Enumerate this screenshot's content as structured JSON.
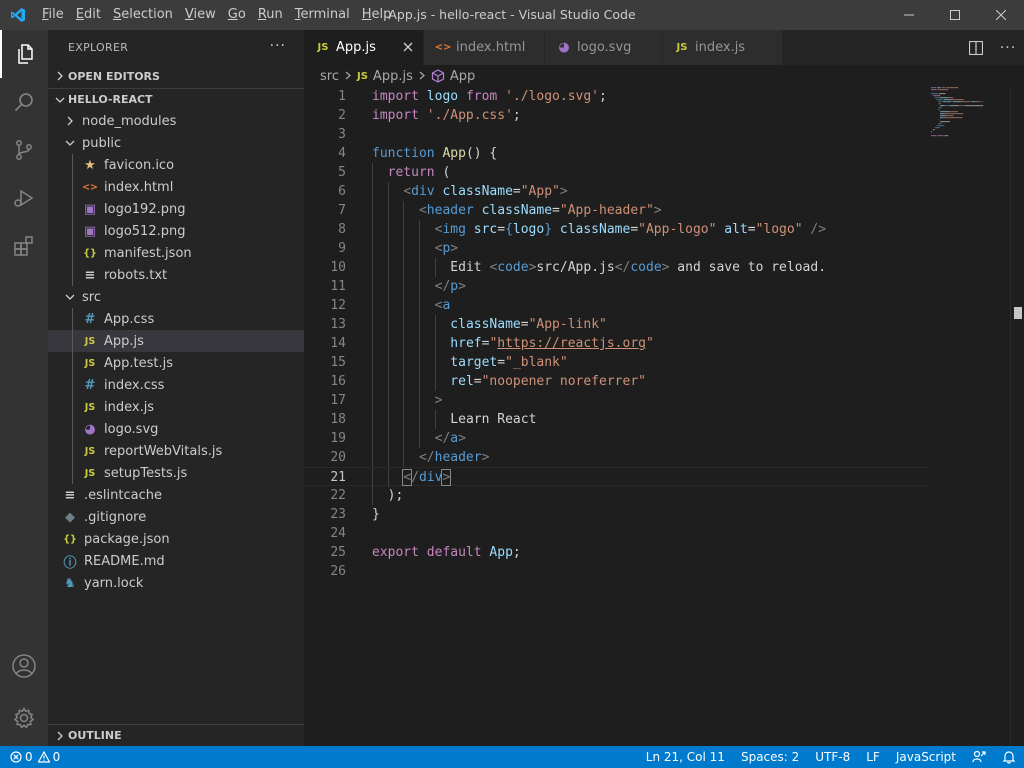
{
  "window": {
    "title": "App.js - hello-react - Visual Studio Code"
  },
  "menu": [
    {
      "u": "F",
      "rest": "ile"
    },
    {
      "u": "E",
      "rest": "dit"
    },
    {
      "u": "S",
      "rest": "election"
    },
    {
      "u": "V",
      "rest": "iew"
    },
    {
      "u": "G",
      "rest": "o"
    },
    {
      "u": "R",
      "rest": "un"
    },
    {
      "u": "T",
      "rest": "erminal"
    },
    {
      "u": "H",
      "rest": "elp"
    }
  ],
  "sidebar": {
    "title": "EXPLORER",
    "open_editors": "OPEN EDITORS",
    "project": "HELLO-REACT",
    "outline": "OUTLINE",
    "tree": [
      {
        "label": "node_modules",
        "type": "folder",
        "open": false,
        "depth": 1
      },
      {
        "label": "public",
        "type": "folder",
        "open": true,
        "depth": 1
      },
      {
        "label": "favicon.ico",
        "type": "file",
        "icon": "star-icon",
        "glyph": "★",
        "color": "#e5c07b",
        "depth": 2
      },
      {
        "label": "index.html",
        "type": "file",
        "icon": "html-icon",
        "glyph": "<>",
        "color": "#e37933",
        "depth": 2
      },
      {
        "label": "logo192.png",
        "type": "file",
        "icon": "image-icon",
        "glyph": "▣",
        "color": "#a074c4",
        "depth": 2
      },
      {
        "label": "logo512.png",
        "type": "file",
        "icon": "image-icon",
        "glyph": "▣",
        "color": "#a074c4",
        "depth": 2
      },
      {
        "label": "manifest.json",
        "type": "file",
        "icon": "json-icon",
        "glyph": "{}",
        "color": "#cbcb41",
        "depth": 2
      },
      {
        "label": "robots.txt",
        "type": "file",
        "icon": "text-file-icon",
        "glyph": "≡",
        "color": "#cccccc",
        "depth": 2
      },
      {
        "label": "src",
        "type": "folder",
        "open": true,
        "depth": 1
      },
      {
        "label": "App.css",
        "type": "file",
        "icon": "css-icon",
        "glyph": "#",
        "color": "#519aba",
        "depth": 2
      },
      {
        "label": "App.js",
        "type": "file",
        "icon": "js-icon",
        "glyph": "JS",
        "color": "#cbcb41",
        "depth": 2,
        "selected": true
      },
      {
        "label": "App.test.js",
        "type": "file",
        "icon": "js-icon",
        "glyph": "JS",
        "color": "#cbcb41",
        "depth": 2
      },
      {
        "label": "index.css",
        "type": "file",
        "icon": "css-icon",
        "glyph": "#",
        "color": "#519aba",
        "depth": 2
      },
      {
        "label": "index.js",
        "type": "file",
        "icon": "js-icon",
        "glyph": "JS",
        "color": "#cbcb41",
        "depth": 2
      },
      {
        "label": "logo.svg",
        "type": "file",
        "icon": "svg-icon",
        "glyph": "◕",
        "color": "#a074c4",
        "depth": 2
      },
      {
        "label": "reportWebVitals.js",
        "type": "file",
        "icon": "js-icon",
        "glyph": "JS",
        "color": "#cbcb41",
        "depth": 2
      },
      {
        "label": "setupTests.js",
        "type": "file",
        "icon": "js-icon",
        "glyph": "JS",
        "color": "#cbcb41",
        "depth": 2
      },
      {
        "label": ".eslintcache",
        "type": "file",
        "icon": "text-file-icon",
        "glyph": "≡",
        "color": "#cccccc",
        "depth": 1
      },
      {
        "label": ".gitignore",
        "type": "file",
        "icon": "git-icon",
        "glyph": "◆",
        "color": "#6d8086",
        "depth": 1
      },
      {
        "label": "package.json",
        "type": "file",
        "icon": "json-icon",
        "glyph": "{}",
        "color": "#cbcb41",
        "depth": 1
      },
      {
        "label": "README.md",
        "type": "file",
        "icon": "info-icon",
        "glyph": "ⓘ",
        "color": "#519aba",
        "depth": 1
      },
      {
        "label": "yarn.lock",
        "type": "file",
        "icon": "yarn-icon",
        "glyph": "♞",
        "color": "#519aba",
        "depth": 1
      }
    ]
  },
  "tabs": [
    {
      "label": "App.js",
      "icon": "js-icon",
      "glyph": "JS",
      "color": "#cbcb41",
      "active": true,
      "width": 120
    },
    {
      "label": "index.html",
      "icon": "html-icon",
      "glyph": "<>",
      "color": "#e37933",
      "active": false,
      "width": 121
    },
    {
      "label": "logo.svg",
      "icon": "svg-icon",
      "glyph": "◕",
      "color": "#a074c4",
      "active": false,
      "width": 118
    },
    {
      "label": "index.js",
      "icon": "js-icon",
      "glyph": "JS",
      "color": "#cbcb41",
      "active": false,
      "width": 120
    }
  ],
  "breadcrumb": {
    "folder": "src",
    "file": "App.js",
    "symbol": "App"
  },
  "editor": {
    "current_line": 21,
    "lines": [
      {
        "n": 1,
        "indent": 0,
        "t": [
          [
            "kw",
            "import"
          ],
          [
            "text",
            " "
          ],
          [
            "var",
            "logo"
          ],
          [
            "text",
            " "
          ],
          [
            "kw",
            "from"
          ],
          [
            "text",
            " "
          ],
          [
            "str",
            "'./logo.svg'"
          ],
          [
            "text",
            ";"
          ]
        ]
      },
      {
        "n": 2,
        "indent": 0,
        "t": [
          [
            "kw",
            "import"
          ],
          [
            "text",
            " "
          ],
          [
            "str",
            "'./App.css'"
          ],
          [
            "text",
            ";"
          ]
        ]
      },
      {
        "n": 3,
        "indent": 0,
        "t": []
      },
      {
        "n": 4,
        "indent": 0,
        "t": [
          [
            "blue",
            "function"
          ],
          [
            "text",
            " "
          ],
          [
            "fn",
            "App"
          ],
          [
            "text",
            "() {"
          ]
        ]
      },
      {
        "n": 5,
        "indent": 1,
        "t": [
          [
            "kw",
            "return"
          ],
          [
            "text",
            " ("
          ]
        ]
      },
      {
        "n": 6,
        "indent": 2,
        "t": [
          [
            "punct",
            "<"
          ],
          [
            "tag",
            "div"
          ],
          [
            "text",
            " "
          ],
          [
            "var",
            "className"
          ],
          [
            "text",
            "="
          ],
          [
            "str",
            "\"App\""
          ],
          [
            "punct",
            ">"
          ]
        ]
      },
      {
        "n": 7,
        "indent": 3,
        "t": [
          [
            "punct",
            "<"
          ],
          [
            "tag",
            "header"
          ],
          [
            "text",
            " "
          ],
          [
            "var",
            "className"
          ],
          [
            "text",
            "="
          ],
          [
            "str",
            "\"App-header\""
          ],
          [
            "punct",
            ">"
          ]
        ]
      },
      {
        "n": 8,
        "indent": 4,
        "t": [
          [
            "punct",
            "<"
          ],
          [
            "tag",
            "img"
          ],
          [
            "text",
            " "
          ],
          [
            "var",
            "src"
          ],
          [
            "text",
            "="
          ],
          [
            "blue",
            "{"
          ],
          [
            "var",
            "logo"
          ],
          [
            "blue",
            "}"
          ],
          [
            "text",
            " "
          ],
          [
            "var",
            "className"
          ],
          [
            "text",
            "="
          ],
          [
            "str",
            "\"App-logo\""
          ],
          [
            "text",
            " "
          ],
          [
            "var",
            "alt"
          ],
          [
            "text",
            "="
          ],
          [
            "str",
            "\"logo\""
          ],
          [
            "text",
            " "
          ],
          [
            "punct",
            "/>"
          ]
        ]
      },
      {
        "n": 9,
        "indent": 4,
        "t": [
          [
            "punct",
            "<"
          ],
          [
            "tag",
            "p"
          ],
          [
            "punct",
            ">"
          ]
        ]
      },
      {
        "n": 10,
        "indent": 5,
        "t": [
          [
            "text",
            "Edit "
          ],
          [
            "punct",
            "<"
          ],
          [
            "tag",
            "code"
          ],
          [
            "punct",
            ">"
          ],
          [
            "text",
            "src/App.js"
          ],
          [
            "punct",
            "</"
          ],
          [
            "tag",
            "code"
          ],
          [
            "punct",
            ">"
          ],
          [
            "text",
            " and save to reload."
          ]
        ]
      },
      {
        "n": 11,
        "indent": 4,
        "t": [
          [
            "punct",
            "</"
          ],
          [
            "tag",
            "p"
          ],
          [
            "punct",
            ">"
          ]
        ]
      },
      {
        "n": 12,
        "indent": 4,
        "t": [
          [
            "punct",
            "<"
          ],
          [
            "tag",
            "a"
          ]
        ]
      },
      {
        "n": 13,
        "indent": 5,
        "t": [
          [
            "var",
            "className"
          ],
          [
            "text",
            "="
          ],
          [
            "str",
            "\"App-link\""
          ]
        ]
      },
      {
        "n": 14,
        "indent": 5,
        "t": [
          [
            "var",
            "href"
          ],
          [
            "text",
            "="
          ],
          [
            "str",
            "\""
          ],
          [
            "url",
            "https://reactjs.org"
          ],
          [
            "str",
            "\""
          ]
        ]
      },
      {
        "n": 15,
        "indent": 5,
        "t": [
          [
            "var",
            "target"
          ],
          [
            "text",
            "="
          ],
          [
            "str",
            "\"_blank\""
          ]
        ]
      },
      {
        "n": 16,
        "indent": 5,
        "t": [
          [
            "var",
            "rel"
          ],
          [
            "text",
            "="
          ],
          [
            "str",
            "\"noopener noreferrer\""
          ]
        ]
      },
      {
        "n": 17,
        "indent": 4,
        "t": [
          [
            "punct",
            ">"
          ]
        ]
      },
      {
        "n": 18,
        "indent": 5,
        "t": [
          [
            "text",
            "Learn React"
          ]
        ]
      },
      {
        "n": 19,
        "indent": 4,
        "t": [
          [
            "punct",
            "</"
          ],
          [
            "tag",
            "a"
          ],
          [
            "punct",
            ">"
          ]
        ]
      },
      {
        "n": 20,
        "indent": 3,
        "t": [
          [
            "punct",
            "</"
          ],
          [
            "tag",
            "header"
          ],
          [
            "punct",
            ">"
          ]
        ]
      },
      {
        "n": 21,
        "indent": 2,
        "t": [
          [
            "bracket",
            "<"
          ],
          [
            "punct",
            "/"
          ],
          [
            "tag",
            "div"
          ],
          [
            "bracket",
            ">"
          ]
        ]
      },
      {
        "n": 22,
        "indent": 1,
        "t": [
          [
            "text",
            ");"
          ]
        ]
      },
      {
        "n": 23,
        "indent": 0,
        "t": [
          [
            "text",
            "}"
          ]
        ]
      },
      {
        "n": 24,
        "indent": 0,
        "t": []
      },
      {
        "n": 25,
        "indent": 0,
        "t": [
          [
            "kw",
            "export"
          ],
          [
            "text",
            " "
          ],
          [
            "kw",
            "default"
          ],
          [
            "text",
            " "
          ],
          [
            "var",
            "App"
          ],
          [
            "text",
            ";"
          ]
        ]
      },
      {
        "n": 26,
        "indent": 0,
        "t": []
      }
    ]
  },
  "status": {
    "errors": "0",
    "warnings": "0",
    "position": "Ln 21, Col 11",
    "spaces": "Spaces: 2",
    "encoding": "UTF-8",
    "eol": "LF",
    "language": "JavaScript"
  },
  "colors": {
    "accent": "#007acc",
    "titlebar": "#3c3c3c",
    "activitybar": "#333333",
    "sidebar": "#252526",
    "editor": "#1e1e1e"
  }
}
